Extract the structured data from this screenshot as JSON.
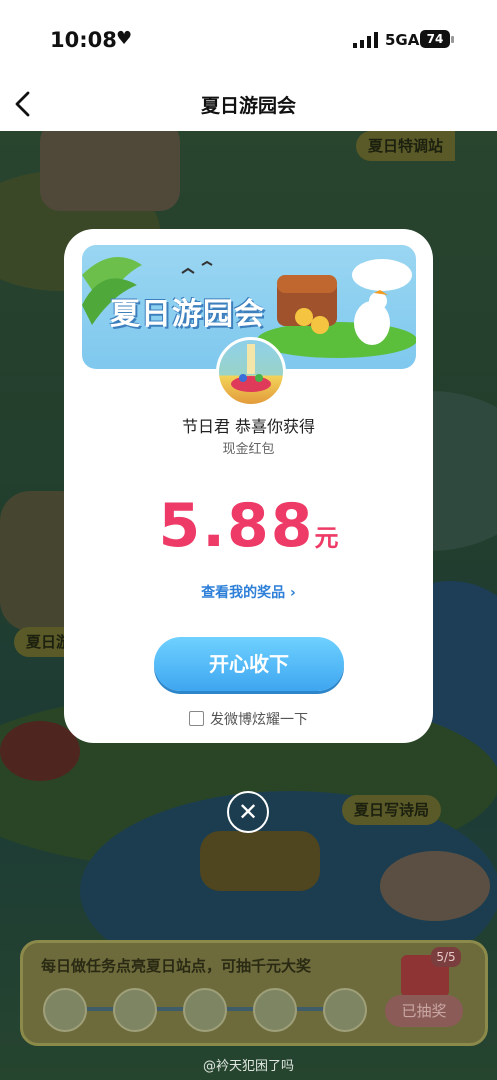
{
  "status_bar": {
    "time": "10:08",
    "network": "5GA",
    "battery": "74"
  },
  "nav": {
    "title": "夏日游园会"
  },
  "background": {
    "stations": [
      "夏日特调站",
      "夏日游园会",
      "夏日写诗局"
    ],
    "task_panel": {
      "text": "每日做任务点亮夏日站点，可抽千元大奖",
      "progress": "5/5",
      "button": "已抽奖"
    }
  },
  "modal": {
    "banner_title": "夏日游园会",
    "congrats": "节日君 恭喜你获得",
    "prize_type": "现金红包",
    "amount": "5.88",
    "unit": "元",
    "view_prizes": "查看我的奖品 ›",
    "accept_button": "开心收下",
    "share_label": "发微博炫耀一下"
  },
  "watermark": "@衿天犯困了吗"
}
